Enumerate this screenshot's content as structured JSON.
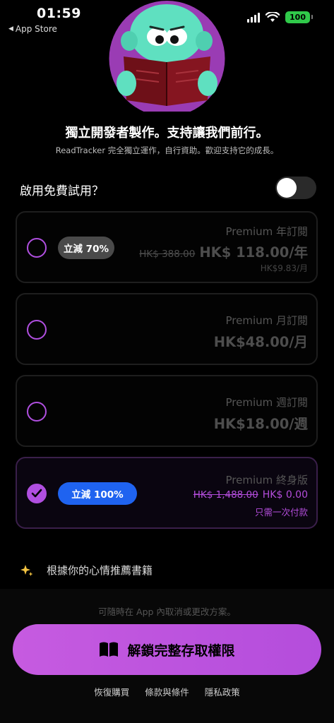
{
  "status_bar": {
    "time": "01:59",
    "back_app": "App Store",
    "battery": "100",
    "back_arrow": "◀"
  },
  "header": {
    "title": "獨立開發者製作。支持讓我們前行。",
    "subtitle": "ReadTracker 完全獨立運作，自行資助。歡迎支持它的成長。"
  },
  "trial": {
    "label": "啟用免費試用？",
    "enabled": false
  },
  "plans": [
    {
      "name": "Premium 年訂閱",
      "badge": "立減 70%",
      "old_price": "HK$ 388.00",
      "price": "HK$ 118.00/年",
      "sub": "HK$9.83/月",
      "selected": false,
      "badge_color": "#4a4a4a"
    },
    {
      "name": "Premium 月訂閱",
      "price": "HK$48.00/月",
      "selected": false
    },
    {
      "name": "Premium 週訂閱",
      "price": "HK$18.00/週",
      "selected": false
    },
    {
      "name": "Premium 終身版",
      "badge": "立減 100%",
      "old_price": "HK$ 1,488.00",
      "price": "HK$ 0.00",
      "sub": "只需一次付款",
      "selected": true,
      "badge_color": "#1f63f0"
    }
  ],
  "feature": {
    "icon": "sparkles-icon",
    "label": "根據你的心情推薦書籍"
  },
  "cancel_note": "可隨時在 App 內取消或更改方案。",
  "cta": {
    "icon": "book-open-icon",
    "label": "解鎖完整存取權限"
  },
  "footer": {
    "restore": "恢復購買",
    "terms": "條款與條件",
    "privacy": "隱私政策"
  },
  "colors": {
    "accent": "#b44ddc",
    "background": "#000000"
  }
}
